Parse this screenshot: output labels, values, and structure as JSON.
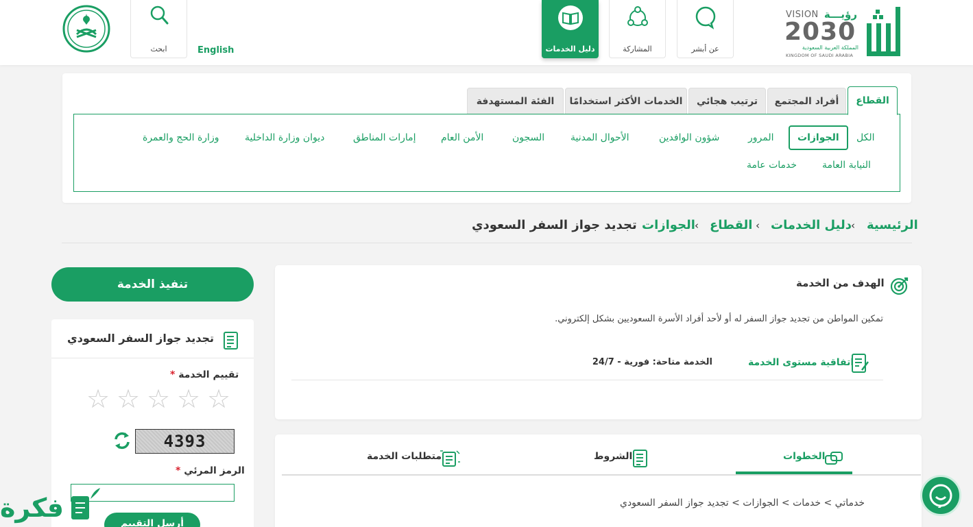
{
  "colors": {
    "accent": "#1a9e63",
    "required": "#d9232f",
    "background": "#f3f3f3"
  },
  "header": {
    "language_link": "English",
    "search_label": "ابحث",
    "nav": [
      {
        "label": "دليل الخدمات",
        "icon": "book-icon",
        "active": true
      },
      {
        "label": "المشاركة",
        "icon": "people-icon",
        "active": false
      },
      {
        "label": "عن أبشر",
        "icon": "chat-icon",
        "active": false
      }
    ],
    "vision": {
      "en_title": "VISION",
      "ar_title": "رؤيـــة",
      "year": "2030",
      "ar_kingdom": "المملكة العربية السعودية",
      "en_kingdom": "KINGDOM OF SAUDI ARABIA"
    },
    "absher_logo": "أبشر"
  },
  "sector_tabs": [
    {
      "label": "القطاع",
      "active": true
    },
    {
      "label": "أفراد المجتمع",
      "active": false
    },
    {
      "label": "ترتيب هجائي",
      "active": false
    },
    {
      "label": "الخدمات الأكثر استخدامًا",
      "active": false
    },
    {
      "label": "الفئة المستهدفة",
      "active": false
    }
  ],
  "sectors": {
    "row1": [
      "الكل",
      "الجوازات",
      "المرور",
      "شؤون الوافدين",
      "الأحوال المدنية",
      "السجون",
      "الأمن العام",
      "إمارات المناطق",
      "ديوان وزارة الداخلية",
      "وزارة الحج والعمرة"
    ],
    "row2": [
      "النيابة العامة",
      "خدمات عامة"
    ],
    "active": "الجوازات"
  },
  "breadcrumb": {
    "items": [
      "الرئيسية",
      "دليل الخدمات",
      "القطاع",
      "الجوازات",
      "تجديد جواز السفر السعودي"
    ],
    "separator": "‹"
  },
  "service_goal": {
    "title": "الهدف من الخدمة",
    "description": "تمكين المواطن من تجديد جواز السفر له أو لأحد أفراد الأسرة السعوديين بشكل إلكتروني.",
    "sla_link": "اتفاقية مستوى الخدمة",
    "availability": "الخدمة متاحة: فورية - 24/7"
  },
  "service_tabs": [
    {
      "label": "الخطوات",
      "icon": "steps-icon",
      "active": true
    },
    {
      "label": "الشروط",
      "icon": "checklist-icon",
      "active": false
    },
    {
      "label": "متطلبات الخدمة",
      "icon": "requirements-icon",
      "active": false
    }
  ],
  "steps_path": "خدماتي > خدمات > الجوازات > تجديد جواز السفر السعودي",
  "left_panel": {
    "execute_button": "تنفيذ الخدمة",
    "service_title": "تجديد جواز السفر السعودي",
    "rating_label": "تقييم الخدمة",
    "required_mark": "*",
    "stars_total": 5,
    "stars_selected": 0,
    "captcha_text": "4393",
    "captcha_label": "الرمز المرئي",
    "captcha_input_value": "",
    "send_button": "أرسل التقييم"
  },
  "watermark": "فكرة"
}
